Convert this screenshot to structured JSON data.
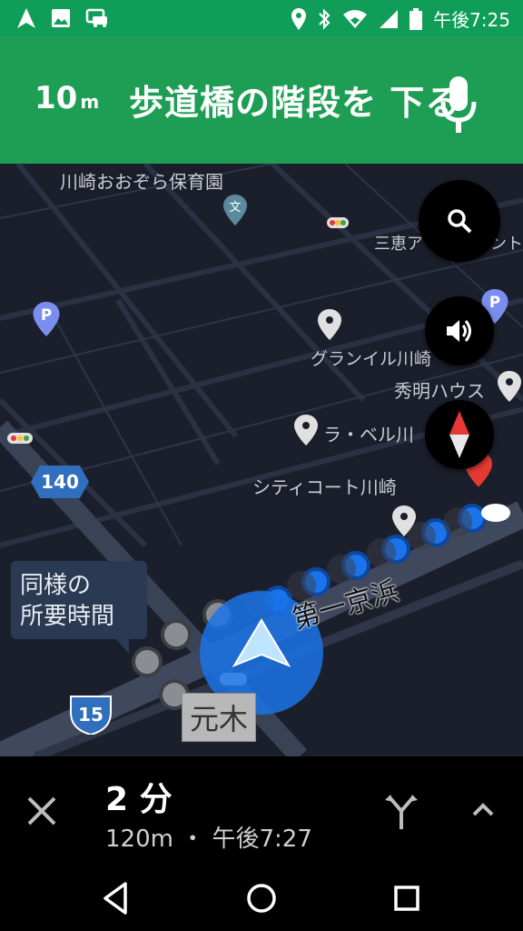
{
  "status_bar": {
    "time": "午後7:25",
    "left_icons": [
      "navigation-icon",
      "image-icon",
      "car-notification-icon"
    ],
    "right_icons": [
      "location-icon",
      "bluetooth-icon",
      "wifi-icon",
      "signal-icon",
      "battery-icon"
    ],
    "color": "#0f9d58"
  },
  "banner": {
    "distance_value": "10",
    "distance_unit": "m",
    "instruction": "歩道橋の階段を 下る",
    "color": "#1e9e55"
  },
  "map": {
    "labels": {
      "nursery": "川崎おおぞら保育園",
      "sankei": "三恵ア",
      "sankei_suffix": "ント",
      "granile": "グランイル川崎",
      "shumei": "秀明ハウス",
      "labelle": "ラ・ベル川",
      "citycourt": "シティコート川崎"
    },
    "street_name": "第一京浜",
    "station_label": "元木",
    "route_shields": [
      "140",
      "15"
    ],
    "tooltip": {
      "line1": "同様の",
      "line2": "所要時間"
    },
    "colors": {
      "route_blue": "#1a73e8",
      "route_gray": "#5f6368",
      "map_bg": "#1b1f2b"
    }
  },
  "bottom_sheet": {
    "eta_value": "2 分",
    "distance_and_arrival": "120m ・ 午後7:27"
  }
}
